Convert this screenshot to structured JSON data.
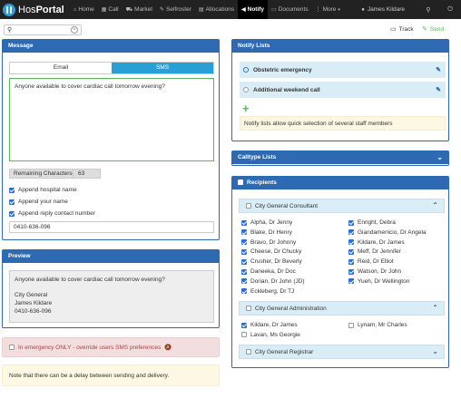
{
  "nav": {
    "brand_a": "Hos",
    "brand_b": "Portal",
    "items": [
      {
        "label": "Home",
        "icon": "home-icon",
        "glyph": "⌂"
      },
      {
        "label": "Call",
        "icon": "calendar-icon",
        "glyph": "▦"
      },
      {
        "label": "Market",
        "icon": "cart-icon",
        "glyph": "⛟"
      },
      {
        "label": "Selfroster",
        "icon": "edit-icon",
        "glyph": "✎"
      },
      {
        "label": "Allocations",
        "icon": "grid-icon",
        "glyph": "▤"
      },
      {
        "label": "Notify",
        "icon": "megaphone-icon",
        "glyph": "📢"
      },
      {
        "label": "Documents",
        "icon": "folder-icon",
        "glyph": "▭"
      },
      {
        "label": "More",
        "icon": "more-icon",
        "glyph": "⋮"
      }
    ],
    "user": "James Kildare"
  },
  "search": {
    "placeholder": ""
  },
  "actions": {
    "track": "Track",
    "send": "Send"
  },
  "message": {
    "title": "Message",
    "tab_email": "Email",
    "tab_sms": "SMS",
    "text": "Anyone available to cover cardiac call tomorrow evening?",
    "remaining_label": "Remaining Characters",
    "remaining_value": "63",
    "opt_hospital": "Append hospital name",
    "opt_name": "Append your name",
    "opt_reply": "Append reply contact number",
    "reply_number": "0410-636-096"
  },
  "preview": {
    "title": "Preview",
    "line1": "Anyone available to cover cardiac call tomorrow evening?",
    "line2": "City General",
    "line3": "James Kildare",
    "line4": "0410-636-096"
  },
  "emergency": "In emergency ONLY - override users SMS preferences",
  "delay_note": "Note that there can be a delay between sending and delivery.",
  "notify_lists": {
    "title": "Notify Lists",
    "items": [
      "Obstetric emergency",
      "Additional weekend call"
    ],
    "note": "Notify lists allow quick selection of several staff members"
  },
  "calltype": {
    "title": "Calltype Lists"
  },
  "recipients": {
    "title": "Recipients",
    "groups": [
      {
        "name": "City General Consultant",
        "left": [
          "Alpha, Dr Jenny",
          "Blake, Dr Henry",
          "Bravo, Dr Johnny",
          "Cheese, Dr Chucky",
          "Crusher, Dr Beverly",
          "Daneeka, Dr Doc",
          "Dorian, Dr John (JD)",
          "Eckleberg, Dr TJ"
        ],
        "right": [
          "Enright, Debra",
          "Giandamenicio, Dr Angela",
          "Kildare, Dr James",
          "Meff, Dr Jennifer",
          "Reid, Dr Elliot",
          "Watson, Dr John",
          "Yueh, Dr Wellington"
        ]
      },
      {
        "name": "City General Administration",
        "left": [
          "Kildare, Dr James",
          "Lavan, Ms Georgie"
        ],
        "right": [
          "Lynam, Mr Charles"
        ]
      },
      {
        "name": "City General Registrar"
      }
    ]
  }
}
